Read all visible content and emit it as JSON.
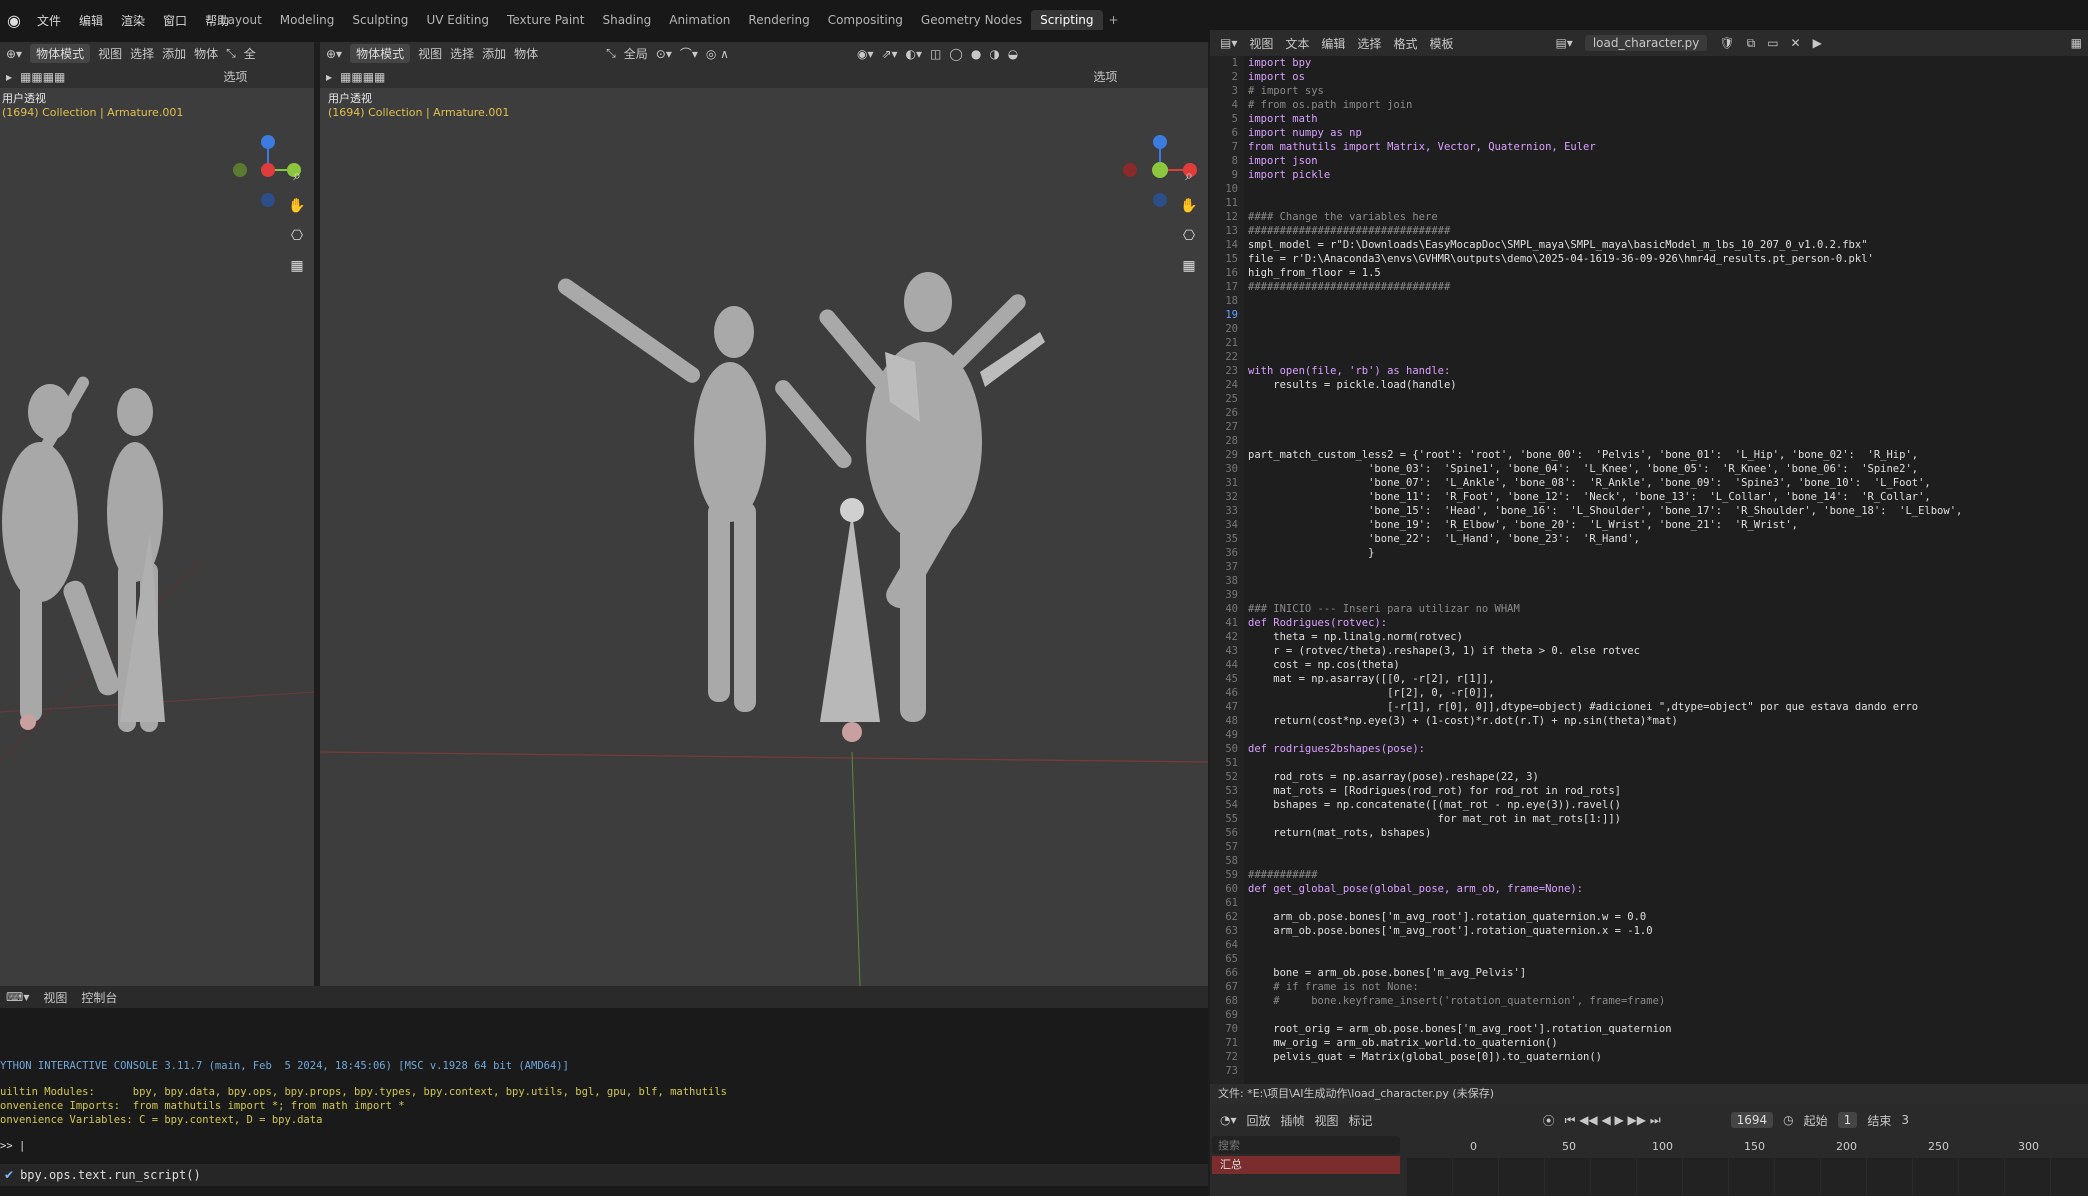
{
  "app": {
    "menu": [
      "文件",
      "编辑",
      "渲染",
      "窗口",
      "帮助"
    ],
    "workspace_tabs": [
      {
        "label": "Layout"
      },
      {
        "label": "Modeling"
      },
      {
        "label": "Sculpting"
      },
      {
        "label": "UV Editing"
      },
      {
        "label": "Texture Paint"
      },
      {
        "label": "Shading"
      },
      {
        "label": "Animation"
      },
      {
        "label": "Rendering"
      },
      {
        "label": "Compositing"
      },
      {
        "label": "Geometry Nodes"
      },
      {
        "label": "Scripting",
        "active": true
      }
    ],
    "add_tab": "+"
  },
  "viewport_left": {
    "mode": "物体模式",
    "menus": [
      "视图",
      "选择",
      "添加",
      "物体"
    ],
    "options": "选项",
    "global": "全",
    "title": "用户透视",
    "subtitle": "(1694) Collection | Armature.001"
  },
  "viewport_main": {
    "mode": "物体模式",
    "menus": [
      "视图",
      "选择",
      "添加",
      "物体"
    ],
    "options": "选项",
    "global": "全局",
    "title": "用户透视",
    "subtitle": "(1694) Collection | Armature.001"
  },
  "text_editor": {
    "menus": [
      "视图",
      "文本",
      "编辑",
      "选择",
      "格式",
      "模板"
    ],
    "filename": "load_character.py",
    "current_line": 19,
    "lines": [
      "import bpy",
      "import os",
      "# import sys",
      "# from os.path import join",
      "import math",
      "import numpy as np",
      "from mathutils import Matrix, Vector, Quaternion, Euler",
      "import json",
      "import pickle",
      "",
      "",
      "#### Change the variables here",
      "################################",
      "smpl_model = r\"D:\\Downloads\\EasyMocapDoc\\SMPL_maya\\SMPL_maya\\basicModel_m_lbs_10_207_0_v1.0.2.fbx\"",
      "file = r'D:\\Anaconda3\\envs\\GVHMR\\outputs\\demo\\2025-04-1619-36-09-926\\hmr4d_results.pt_person-0.pkl'",
      "high_from_floor = 1.5",
      "################################",
      "",
      "",
      "",
      "",
      "",
      "with open(file, 'rb') as handle:",
      "    results = pickle.load(handle)",
      "",
      "",
      "",
      "",
      "part_match_custom_less2 = {'root': 'root', 'bone_00':  'Pelvis', 'bone_01':  'L_Hip', 'bone_02':  'R_Hip',",
      "                   'bone_03':  'Spine1', 'bone_04':  'L_Knee', 'bone_05':  'R_Knee', 'bone_06':  'Spine2',",
      "                   'bone_07':  'L_Ankle', 'bone_08':  'R_Ankle', 'bone_09':  'Spine3', 'bone_10':  'L_Foot',",
      "                   'bone_11':  'R_Foot', 'bone_12':  'Neck', 'bone_13':  'L_Collar', 'bone_14':  'R_Collar',",
      "                   'bone_15':  'Head', 'bone_16':  'L_Shoulder', 'bone_17':  'R_Shoulder', 'bone_18':  'L_Elbow',",
      "                   'bone_19':  'R_Elbow', 'bone_20':  'L_Wrist', 'bone_21':  'R_Wrist',",
      "                   'bone_22':  'L_Hand', 'bone_23':  'R_Hand',",
      "                   }",
      "",
      "",
      "",
      "### INICIO --- Inseri para utilizar no WHAM",
      "def Rodrigues(rotvec):",
      "    theta = np.linalg.norm(rotvec)",
      "    r = (rotvec/theta).reshape(3, 1) if theta > 0. else rotvec",
      "    cost = np.cos(theta)",
      "    mat = np.asarray([[0, -r[2], r[1]],",
      "                      [r[2], 0, -r[0]],",
      "                      [-r[1], r[0], 0]],dtype=object) #adicionei \",dtype=object\" por que estava dando erro",
      "    return(cost*np.eye(3) + (1-cost)*r.dot(r.T) + np.sin(theta)*mat)",
      "",
      "def rodrigues2bshapes(pose):",
      "",
      "    rod_rots = np.asarray(pose).reshape(22, 3)",
      "    mat_rots = [Rodrigues(rod_rot) for rod_rot in rod_rots]",
      "    bshapes = np.concatenate([(mat_rot - np.eye(3)).ravel()",
      "                              for mat_rot in mat_rots[1:]])",
      "    return(mat_rots, bshapes)",
      "",
      "",
      "###########",
      "def get_global_pose(global_pose, arm_ob, frame=None):",
      "",
      "    arm_ob.pose.bones['m_avg_root'].rotation_quaternion.w = 0.0",
      "    arm_ob.pose.bones['m_avg_root'].rotation_quaternion.x = -1.0",
      "",
      "",
      "    bone = arm_ob.pose.bones['m_avg_Pelvis']",
      "    # if frame is not None:",
      "    #     bone.keyframe_insert('rotation_quaternion', frame=frame)",
      "",
      "    root_orig = arm_ob.pose.bones['m_avg_root'].rotation_quaternion",
      "    mw_orig = arm_ob.matrix_world.to_quaternion()",
      "    pelvis_quat = Matrix(global_pose[0]).to_quaternion()",
      ""
    ]
  },
  "status_bar": "文件: *E:\\项目\\AI生成动作\\load_character.py (未保存)",
  "console": {
    "menus": [
      "视图",
      "控制台"
    ],
    "lines": [
      "YTHON INTERACTIVE CONSOLE 3.11.7 (main, Feb  5 2024, 18:45:06) [MSC v.1928 64 bit (AMD64)]",
      "",
      "uiltin Modules:      bpy, bpy.data, bpy.ops, bpy.props, bpy.types, bpy.context, bpy.utils, bgl, gpu, blf, mathutils",
      "onvenience Imports:  from mathutils import *; from math import *",
      "onvenience Variables: C = bpy.context, D = bpy.data"
    ],
    "prompt": ">> |",
    "last_op": "bpy.ops.text.run_script()"
  },
  "timeline": {
    "menus": [
      "回放",
      "插帧",
      "视图",
      "标记"
    ],
    "current_frame": "1694",
    "start_label": "起始",
    "start": "1",
    "end_label": "结束",
    "end": "3",
    "search_placeholder": "搜索",
    "summary": "汇总",
    "ticks": [
      "0",
      "50",
      "100",
      "150",
      "200",
      "250",
      "300"
    ]
  },
  "colors": {
    "accent": "#4772b3",
    "viewport_bg": "#3d3d3d",
    "axis_x": "#e03c3c",
    "axis_y": "#8cc63f",
    "axis_z": "#3c7be0"
  }
}
